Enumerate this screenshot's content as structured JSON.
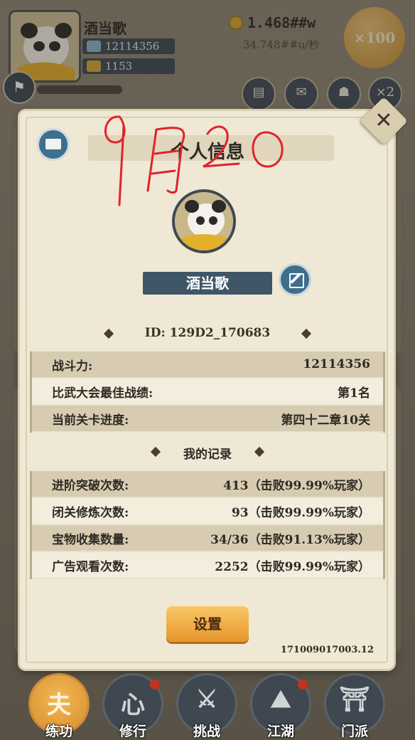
{
  "hud": {
    "player_name": "酒当歌",
    "power_value": "12114356",
    "crowns": "1153",
    "coins": "1.468##w",
    "coin_rate": "34.748##u/秒",
    "multiplier": "×100"
  },
  "dialog": {
    "title": "个人信息",
    "handwriting": "9月20",
    "name": "酒当歌",
    "id_text": "ID: 129D2_170683",
    "stats": [
      {
        "label": "战斗力:",
        "value": "12114356"
      },
      {
        "label": "比武大会最佳战绩:",
        "value": "第1名"
      },
      {
        "label": "当前关卡进度:",
        "value": "第四十二章10关"
      }
    ],
    "records_title": "我的记录",
    "records": [
      {
        "label": "进阶突破次数:",
        "value": "413（击败99.99%玩家）"
      },
      {
        "label": "闭关修炼次数:",
        "value": "93（击败99.99%玩家）"
      },
      {
        "label": "宝物收集数量:",
        "value": "34/36（击败91.13%玩家）"
      },
      {
        "label": "广告观看次数:",
        "value": "2252（击败99.99%玩家）"
      }
    ],
    "settings_label": "设置",
    "version": "171009017003.12"
  },
  "nav": [
    {
      "label": "练功",
      "glyph": "夫",
      "active": true
    },
    {
      "label": "修行",
      "glyph": "心"
    },
    {
      "label": "挑战",
      "glyph": "⚔"
    },
    {
      "label": "江湖",
      "glyph": "⛰"
    },
    {
      "label": "门派",
      "glyph": "⛩"
    }
  ],
  "colors": {
    "accent": "#e7962d",
    "dialog_bg": "#efe8d4",
    "name_bar": "#3f5666"
  }
}
